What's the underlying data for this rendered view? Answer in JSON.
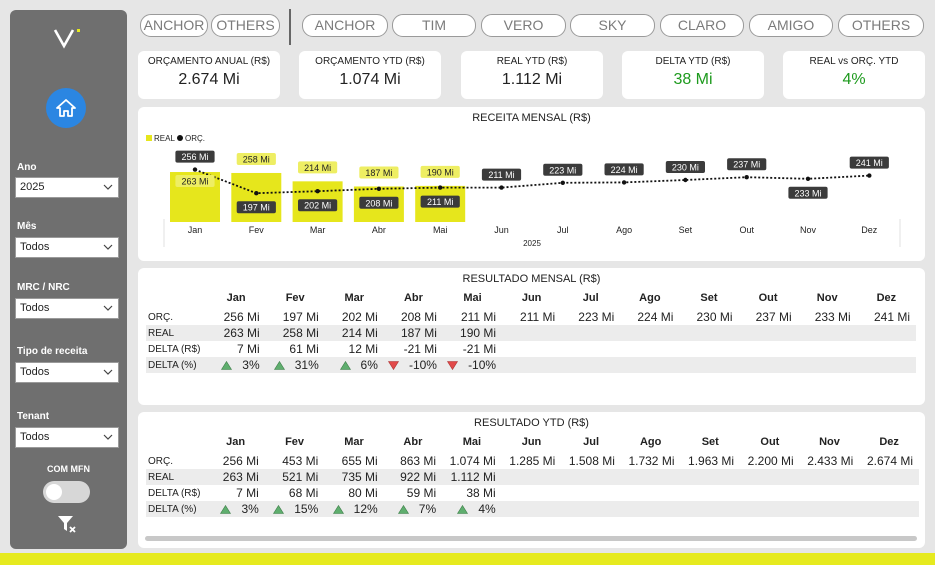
{
  "filters": {
    "ano": {
      "label": "Ano",
      "value": "2025"
    },
    "mes": {
      "label": "Mês",
      "value": "Todos"
    },
    "mrc": {
      "label": "MRC / NRC",
      "value": "Todos"
    },
    "tipo": {
      "label": "Tipo de receita",
      "value": "Todos"
    },
    "tenant": {
      "label": "Tenant",
      "value": "Todos"
    },
    "mfn_label": "COM MFN",
    "mfn_on": false
  },
  "segment_buttons_left": [
    "ANCHOR",
    "OTHERS"
  ],
  "segment_buttons_right": [
    "ANCHOR",
    "TIM",
    "VERO",
    "SKY",
    "CLARO",
    "AMIGO",
    "OTHERS"
  ],
  "kpis": [
    {
      "title": "ORÇAMENTO ANUAL (R$)",
      "value": "2.674 Mi",
      "color": "#222222"
    },
    {
      "title": "ORÇAMENTO YTD (R$)",
      "value": "1.074 Mi",
      "color": "#222222"
    },
    {
      "title": "REAL YTD (R$)",
      "value": "1.112 Mi",
      "color": "#222222"
    },
    {
      "title": "DELTA YTD (R$)",
      "value": "38 Mi",
      "color": "#1d9a1d"
    },
    {
      "title": "REAL vs ORÇ. YTD",
      "value": "4%",
      "color": "#1d9a1d"
    }
  ],
  "chart_title": "RECEITA MENSAL (R$)",
  "chart_data": {
    "type": "bar",
    "title": "RECEITA MENSAL (R$)",
    "xlabel": "2025",
    "categories": [
      "Jan",
      "Fev",
      "Mar",
      "Abr",
      "Mai",
      "Jun",
      "Jul",
      "Ago",
      "Set",
      "Out",
      "Nov",
      "Dez"
    ],
    "series": [
      {
        "name": "REAL",
        "kind": "bar",
        "color": "#e6e61c",
        "values": [
          263,
          258,
          214,
          187,
          190,
          null,
          null,
          null,
          null,
          null,
          null,
          null
        ],
        "labels": [
          "263 Mi",
          "258 Mi",
          "214 Mi",
          "187 Mi",
          "190 Mi",
          "",
          "",
          "",
          "",
          "",
          "",
          ""
        ]
      },
      {
        "name": "ORÇ.",
        "kind": "line",
        "color": "#111111",
        "values": [
          256,
          197,
          202,
          208,
          211,
          211,
          223,
          224,
          230,
          237,
          233,
          241
        ],
        "labels": [
          "256 Mi",
          "197 Mi",
          "202 Mi",
          "208 Mi",
          "211 Mi",
          "211 Mi",
          "223 Mi",
          "224 Mi",
          "230 Mi",
          "237 Mi",
          "233 Mi",
          "241 Mi"
        ]
      }
    ],
    "legend_position": "top-left"
  },
  "mensal": {
    "title": "RESULTADO MENSAL (R$)",
    "months": [
      "Jan",
      "Fev",
      "Mar",
      "Abr",
      "Mai",
      "Jun",
      "Jul",
      "Ago",
      "Set",
      "Out",
      "Nov",
      "Dez"
    ],
    "rows": [
      {
        "label": "ORÇ.",
        "cells": [
          "256 Mi",
          "197 Mi",
          "202 Mi",
          "208 Mi",
          "211 Mi",
          "211 Mi",
          "223 Mi",
          "224 Mi",
          "230 Mi",
          "237 Mi",
          "233 Mi",
          "241 Mi"
        ]
      },
      {
        "label": "REAL",
        "cells": [
          "263 Mi",
          "258 Mi",
          "214 Mi",
          "187 Mi",
          "190 Mi",
          "",
          "",
          "",
          "",
          "",
          "",
          ""
        ]
      },
      {
        "label": "DELTA (R$)",
        "cells": [
          "7 Mi",
          "61 Mi",
          "12 Mi",
          "-21 Mi",
          "-21 Mi",
          "",
          "",
          "",
          "",
          "",
          "",
          ""
        ]
      },
      {
        "label": "DELTA (%)",
        "cells": [
          "3%",
          "31%",
          "6%",
          "-10%",
          "-10%",
          "",
          "",
          "",
          "",
          "",
          "",
          ""
        ],
        "trend": [
          "up",
          "up",
          "up",
          "down",
          "down",
          "",
          "",
          "",
          "",
          "",
          "",
          ""
        ]
      }
    ]
  },
  "ytd": {
    "title": "RESULTADO YTD (R$)",
    "months": [
      "Jan",
      "Fev",
      "Mar",
      "Abr",
      "Mai",
      "Jun",
      "Jul",
      "Ago",
      "Set",
      "Out",
      "Nov",
      "Dez"
    ],
    "rows": [
      {
        "label": "ORÇ.",
        "cells": [
          "256 Mi",
          "453 Mi",
          "655 Mi",
          "863 Mi",
          "1.074 Mi",
          "1.285 Mi",
          "1.508 Mi",
          "1.732 Mi",
          "1.963 Mi",
          "2.200 Mi",
          "2.433 Mi",
          "2.674 Mi"
        ]
      },
      {
        "label": "REAL",
        "cells": [
          "263 Mi",
          "521 Mi",
          "735 Mi",
          "922 Mi",
          "1.112 Mi",
          "",
          "",
          "",
          "",
          "",
          "",
          ""
        ]
      },
      {
        "label": "DELTA (R$)",
        "cells": [
          "7 Mi",
          "68 Mi",
          "80 Mi",
          "59 Mi",
          "38 Mi",
          "",
          "",
          "",
          "",
          "",
          "",
          ""
        ]
      },
      {
        "label": "DELTA (%)",
        "cells": [
          "3%",
          "15%",
          "12%",
          "7%",
          "4%",
          "",
          "",
          "",
          "",
          "",
          "",
          ""
        ],
        "trend": [
          "up",
          "up",
          "up",
          "up",
          "up",
          "",
          "",
          "",
          "",
          "",
          "",
          ""
        ]
      }
    ]
  },
  "colors": {
    "up": "#5fae6e",
    "down": "#e24a4a",
    "home": "#2b86e2",
    "accent": "#e6ea1f"
  }
}
